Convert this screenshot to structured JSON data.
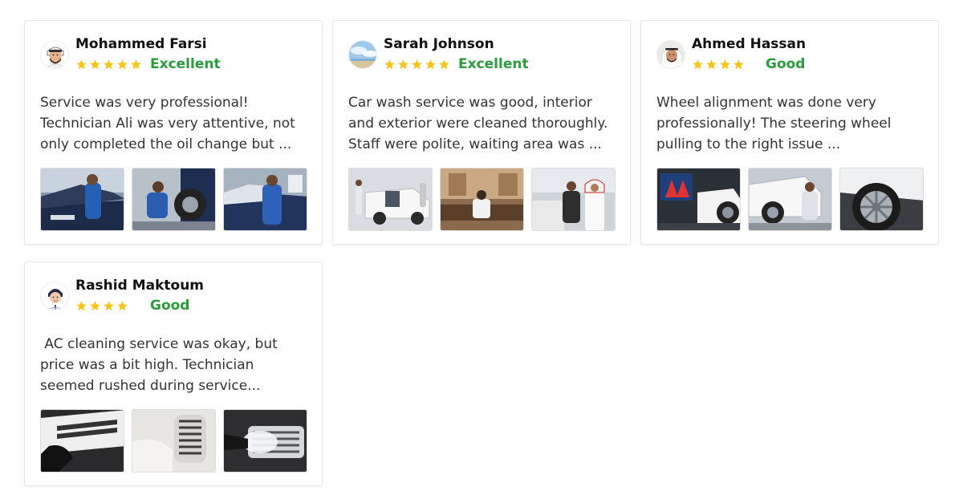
{
  "colors": {
    "star": "#f5c518",
    "rating_label": "#2a9d3b",
    "card_border": "#e7e7e7"
  },
  "reviews": [
    {
      "name": "Mohammed Farsi",
      "stars": 5,
      "rating_label": "Excellent",
      "avatar_icon": "man-keffiyeh-cartoon-avatar",
      "text_line1": "Service was very professional!",
      "text_line2": "Technician Ali was very attentive, not",
      "text_line3": "only completed the oil change but ...",
      "photos": [
        "mechanic-engine-oil-photo",
        "mechanic-tire-photo",
        "mechanic-thumbs-up-photo"
      ]
    },
    {
      "name": "Sarah Johnson",
      "stars": 5,
      "rating_label": "Excellent",
      "avatar_icon": "sky-landscape-avatar",
      "text_line1": "Car wash service was good, interior",
      "text_line2": "and exterior were cleaned thoroughly.",
      "text_line3": "Staff were polite, waiting area was ...",
      "photos": [
        "white-suv-cleaning-photo",
        "waiting-lounge-photo",
        "customer-handover-photo"
      ]
    },
    {
      "name": "Ahmed Hassan",
      "stars": 4,
      "rating_label": "Good",
      "avatar_icon": "man-ghutra-photo-avatar",
      "text_line1": "Wheel alignment was done very",
      "text_line2": "professionally! The steering wheel",
      "text_line3": "pulling to the right issue ...",
      "photos": [
        "alignment-screen-photo",
        "wheel-alignment-photo",
        "alloy-wheel-closeup-photo"
      ]
    },
    {
      "name": "Rashid Maktoum",
      "stars": 4,
      "rating_label": "Good",
      "avatar_icon": "man-cartoon-avatar",
      "text_line1": " AC cleaning service was okay, but",
      "text_line2": "price was a bit high. Technician",
      "text_line3": "seemed rushed during service...",
      "photos": [
        "ac-vent-cleaning-photo",
        "ac-vent-closeup-photo",
        "foam-vent-cleaning-photo"
      ]
    }
  ]
}
